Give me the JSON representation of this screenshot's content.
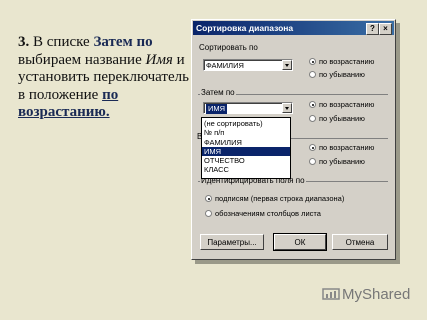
{
  "slide": {
    "step_num": "3.",
    "t1": " В списке ",
    "t_hl": "Затем по",
    "t2": " выбираем название ",
    "t_it": "Имя",
    "t3": " и установить переключатель в положение ",
    "t_bu": "по возрастанию."
  },
  "dialog": {
    "title": "Сортировка диапазона",
    "help": "?",
    "close": "×",
    "sort_by": {
      "label": "Сортировать по",
      "value": "ФАМИЛИЯ",
      "asc": "по возрастанию",
      "desc": "по убыванию"
    },
    "then_by": {
      "label": "Затем по",
      "value": "ИМЯ",
      "asc": "по возрастанию",
      "desc": "по убыванию"
    },
    "then_by2": {
      "label_partial": "В",
      "asc": "по возрастанию",
      "desc": "по убыванию"
    },
    "dropdown_options": [
      "(не сортировать)",
      "№ п/п",
      "ФАМИЛИЯ",
      "ИМЯ",
      "ОТЧЕСТВО",
      "КЛАСС"
    ],
    "identify": {
      "label": "Идентифицировать поля по",
      "opt1": "подписям (первая строка диапазона)",
      "opt2": "обозначениям столбцов листа"
    },
    "buttons": {
      "params": "Параметры...",
      "ok": "ОК",
      "cancel": "Отмена"
    }
  },
  "watermark": "MyShared"
}
